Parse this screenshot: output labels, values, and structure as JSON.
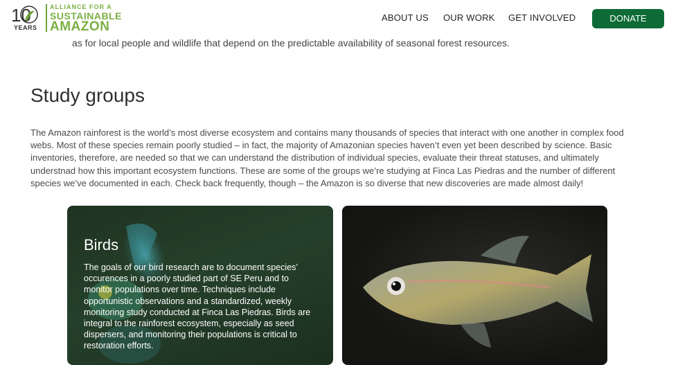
{
  "header": {
    "logo": {
      "number": "10",
      "years": "YEARS",
      "line1": "ALLIANCE FOR A",
      "line2": "SUSTAINABLE",
      "line3": "AMAZON"
    },
    "nav": [
      "ABOUT US",
      "OUR WORK",
      "GET INVOLVED"
    ],
    "donate_label": "DONATE"
  },
  "main": {
    "previous_text": "as for local people and wildlife that depend on the predictable availability of seasonal forest resources.",
    "section_title": "Study groups",
    "intro": "The Amazon rainforest is the world’s most diverse ecosystem and contains many thousands of species that interact with one another in complex food webs. Most of these species remain poorly studied – in fact, the majority of Amazonian species haven’t even yet been described by science. Basic inventories, therefore, are needed so that we can understand the distribution of individual species, evaluate their threat statuses, and ultimately understnad how this important ecosystem functions. These are some of the groups we’re studying at Finca Las Piedras and the number of different species we’ve documented in each. Check back frequently, though – the Amazon is so diverse that new discoveries are made almost daily!",
    "cards": [
      {
        "title": "Birds",
        "text": "The goals of our bird research are to document species’ occurences in a poorly studied part of SE Peru and to monitor populations over time. Techniques include opportunistic observations and a standardized, weekly monitoring study conducted at Finca Las Piedras. Birds are integral to the rainforest ecosystem, especially as seed dispersers, and monitoring their populations is critical to restoration efforts."
      },
      {
        "title": "",
        "text": ""
      }
    ]
  },
  "colors": {
    "brand_green": "#7bb043",
    "donate_green": "#0e6b36"
  }
}
